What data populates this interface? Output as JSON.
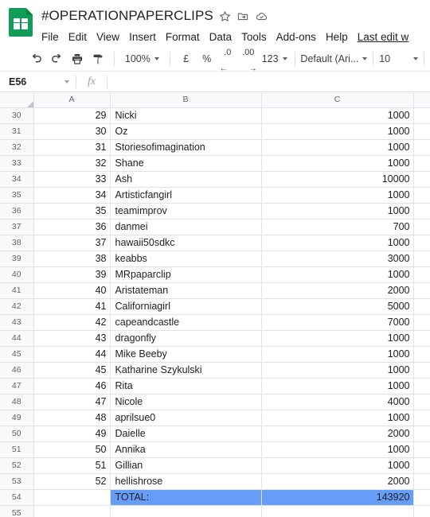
{
  "app": {
    "logo_name": "google-sheets-logo",
    "brand_green": "#0f9d58",
    "selection_blue": "#669df6"
  },
  "header": {
    "doc_title": "#OPERATIONPAPERCLIPS",
    "icons": [
      {
        "name": "star-icon",
        "label": "Star"
      },
      {
        "name": "move-to-folder-icon",
        "label": "Move to folder"
      },
      {
        "name": "cloud-status-icon",
        "label": "Document status"
      }
    ],
    "menus": [
      {
        "label": "File"
      },
      {
        "label": "Edit"
      },
      {
        "label": "View"
      },
      {
        "label": "Insert"
      },
      {
        "label": "Format"
      },
      {
        "label": "Data"
      },
      {
        "label": "Tools"
      },
      {
        "label": "Add-ons"
      },
      {
        "label": "Help"
      }
    ],
    "last_edit": "Last edit w"
  },
  "toolbar": {
    "undo_label": "Undo",
    "redo_label": "Redo",
    "print_label": "Print",
    "paint_format_label": "Paint format",
    "zoom_value": "100%",
    "currency_label": "£",
    "percent_label": "%",
    "decrease_decimal_label": ".0",
    "increase_decimal_label": ".00",
    "number_format_label": "123",
    "font_value": "Default (Ari...",
    "font_size_value": "10"
  },
  "formula_bar": {
    "name_box_value": "E56",
    "fx_label": "fx",
    "formula_value": ""
  },
  "grid": {
    "column_headers": [
      "A",
      "B",
      "C"
    ],
    "rows": [
      {
        "n": "30",
        "a": "29",
        "b": "Nicki",
        "c": "1000"
      },
      {
        "n": "31",
        "a": "30",
        "b": "Oz",
        "c": "1000"
      },
      {
        "n": "32",
        "a": "31",
        "b": "Storiesofimagination",
        "c": "1000"
      },
      {
        "n": "33",
        "a": "32",
        "b": "Shane",
        "c": "1000"
      },
      {
        "n": "34",
        "a": "33",
        "b": "Ash",
        "c": "10000"
      },
      {
        "n": "35",
        "a": "34",
        "b": "Artisticfangirl",
        "c": "1000"
      },
      {
        "n": "36",
        "a": "35",
        "b": "teamimprov",
        "c": "1000"
      },
      {
        "n": "37",
        "a": "36",
        "b": "danmei",
        "c": "700"
      },
      {
        "n": "38",
        "a": "37",
        "b": "hawaii50sdkc",
        "c": "1000"
      },
      {
        "n": "39",
        "a": "38",
        "b": "keabbs",
        "c": "3000"
      },
      {
        "n": "40",
        "a": "39",
        "b": "MRpaparclip",
        "c": "1000"
      },
      {
        "n": "41",
        "a": "40",
        "b": "Aristateman",
        "c": "2000"
      },
      {
        "n": "42",
        "a": "41",
        "b": "Californiagirl",
        "c": "5000"
      },
      {
        "n": "43",
        "a": "42",
        "b": "capeandcastle",
        "c": "7000"
      },
      {
        "n": "44",
        "a": "43",
        "b": "dragonfly",
        "c": "1000"
      },
      {
        "n": "45",
        "a": "44",
        "b": "Mike Beeby",
        "c": "1000"
      },
      {
        "n": "46",
        "a": "45",
        "b": "Katharine Szykulski",
        "c": "1000"
      },
      {
        "n": "47",
        "a": "46",
        "b": "Rita",
        "c": "1000"
      },
      {
        "n": "48",
        "a": "47",
        "b": "Nicole",
        "c": "4000"
      },
      {
        "n": "49",
        "a": "48",
        "b": "aprilsue0",
        "c": "1000"
      },
      {
        "n": "50",
        "a": "49",
        "b": "Daielle",
        "c": "2000"
      },
      {
        "n": "51",
        "a": "50",
        "b": "Annika",
        "c": "1000"
      },
      {
        "n": "52",
        "a": "51",
        "b": "Gillian",
        "c": "1000"
      },
      {
        "n": "53",
        "a": "52",
        "b": "hellishrose",
        "c": "2000"
      }
    ],
    "total_row": {
      "n": "54",
      "a": "",
      "b": "TOTAL:",
      "c": "143920"
    },
    "partial_row": {
      "n": "55",
      "a": "",
      "b": "",
      "c": ""
    }
  }
}
